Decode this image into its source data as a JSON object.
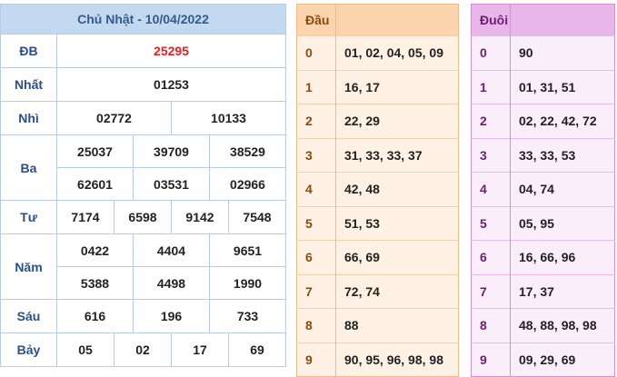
{
  "header": {
    "title": "Chủ Nhật - 10/04/2022"
  },
  "prizes": {
    "db": {
      "label": "ĐB",
      "values": [
        "25295"
      ]
    },
    "nhat": {
      "label": "Nhất",
      "values": [
        "01253"
      ]
    },
    "nhi": {
      "label": "Nhì",
      "values": [
        "02772",
        "10133"
      ]
    },
    "ba": {
      "label": "Ba",
      "values": [
        "25037",
        "39709",
        "38529",
        "62601",
        "03531",
        "02966"
      ]
    },
    "tu": {
      "label": "Tư",
      "values": [
        "7174",
        "6598",
        "9142",
        "7548"
      ]
    },
    "nam": {
      "label": "Năm",
      "values": [
        "0422",
        "4404",
        "9651",
        "5388",
        "4498",
        "1990"
      ]
    },
    "sau": {
      "label": "Sáu",
      "values": [
        "616",
        "196",
        "733"
      ]
    },
    "bay": {
      "label": "Bảy",
      "values": [
        "05",
        "02",
        "17",
        "69"
      ]
    }
  },
  "dau": {
    "header": "Đầu",
    "rows": [
      {
        "key": "0",
        "values": "01, 02, 04, 05, 09"
      },
      {
        "key": "1",
        "values": "16, 17"
      },
      {
        "key": "2",
        "values": "22, 29"
      },
      {
        "key": "3",
        "values": "31, 33, 33, 37"
      },
      {
        "key": "4",
        "values": "42, 48"
      },
      {
        "key": "5",
        "values": "51, 53"
      },
      {
        "key": "6",
        "values": "66, 69"
      },
      {
        "key": "7",
        "values": "72, 74"
      },
      {
        "key": "8",
        "values": "88"
      },
      {
        "key": "9",
        "values": "90, 95, 96, 98, 98"
      }
    ]
  },
  "duoi": {
    "header": "Đuôi",
    "rows": [
      {
        "key": "0",
        "values": "90"
      },
      {
        "key": "1",
        "values": "01, 31, 51"
      },
      {
        "key": "2",
        "values": "02, 22, 42, 72"
      },
      {
        "key": "3",
        "values": "33, 33, 53"
      },
      {
        "key": "4",
        "values": "04, 74"
      },
      {
        "key": "5",
        "values": "05, 95"
      },
      {
        "key": "6",
        "values": "16, 66, 96"
      },
      {
        "key": "7",
        "values": "17, 37"
      },
      {
        "key": "8",
        "values": "48, 88, 98, 98"
      },
      {
        "key": "9",
        "values": "09, 29, 69"
      }
    ]
  },
  "colors": {
    "special": "#e02222",
    "blue_header": "#c3d8f1",
    "orange_header": "#fbd3ac",
    "purple_header": "#e8b6e9"
  }
}
